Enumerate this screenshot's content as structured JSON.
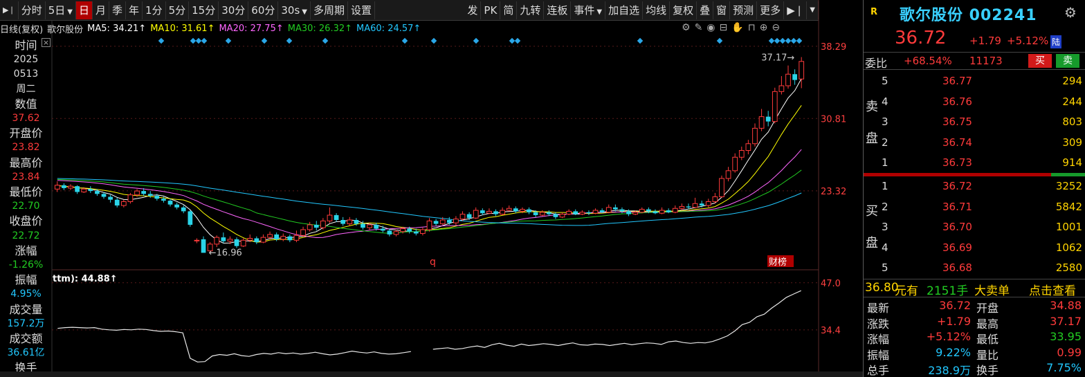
{
  "toolbar": {
    "items": [
      {
        "label": "分时",
        "icon": "arrow-right-bar-icon"
      },
      {
        "label": "5日",
        "caret": true
      },
      {
        "label": "日",
        "active": true
      },
      {
        "label": "月"
      },
      {
        "label": "季"
      },
      {
        "label": "年"
      },
      {
        "label": "1分"
      },
      {
        "label": "5分"
      },
      {
        "label": "15分"
      },
      {
        "label": "30分"
      },
      {
        "label": "60分"
      },
      {
        "label": "30s",
        "caret": true
      },
      {
        "label": "多周期"
      },
      {
        "label": "设置"
      }
    ],
    "right_items": [
      {
        "label": "发"
      },
      {
        "label": "PK"
      },
      {
        "label": "简"
      },
      {
        "label": "九转"
      },
      {
        "label": "连板"
      },
      {
        "label": "事件",
        "caret": true
      },
      {
        "label": "加自选"
      },
      {
        "label": "均线"
      },
      {
        "label": "复权"
      },
      {
        "label": "叠"
      },
      {
        "label": "窗"
      },
      {
        "label": "预测"
      },
      {
        "label": "更多"
      }
    ]
  },
  "legend": {
    "prefix": "日线(复权)",
    "stock": "歌尔股份",
    "ma": [
      {
        "text": "MA5: 34.21↑",
        "color": "#ffffff"
      },
      {
        "text": "MA10: 31.61↑",
        "color": "#ffff00"
      },
      {
        "text": "MA20: 27.75↑",
        "color": "#ff66ff"
      },
      {
        "text": "MA30: 26.32↑",
        "color": "#22cc22"
      },
      {
        "text": "MA60: 24.57↑",
        "color": "#22c8ff"
      }
    ],
    "tool_icons": [
      "gear-icon",
      "pen-icon",
      "eye-icon",
      "toolbox-icon",
      "hand-icon",
      "lock-icon",
      "zoom-in-icon",
      "zoom-out-icon"
    ]
  },
  "datawin": [
    {
      "label": "时间",
      "values": [
        "2025",
        "0513",
        "周二"
      ],
      "color": "#dddddd"
    },
    {
      "label": "数值",
      "values": [
        "37.62"
      ],
      "color": "#ff3b3b"
    },
    {
      "label": "开盘价",
      "values": [
        "23.82"
      ],
      "color": "#ff3b3b"
    },
    {
      "label": "最高价",
      "values": [
        "23.84"
      ],
      "color": "#ff3b3b"
    },
    {
      "label": "最低价",
      "values": [
        "22.70"
      ],
      "color": "#22cc22"
    },
    {
      "label": "收盘价",
      "values": [
        "22.72"
      ],
      "color": "#22cc22"
    },
    {
      "label": "涨幅",
      "values": [
        "-1.26%"
      ],
      "color": "#22cc22"
    },
    {
      "label": "振幅",
      "values": [
        "4.95%"
      ],
      "color": "#22c8ff"
    },
    {
      "label": "成交量",
      "values": [
        "157.2万"
      ],
      "color": "#22c8ff"
    },
    {
      "label": "成交额",
      "values": [
        "36.61亿"
      ],
      "color": "#22c8ff"
    },
    {
      "label": "换手",
      "values": [],
      "color": "#dddddd"
    }
  ],
  "chart_data": {
    "type": "candlestick",
    "price_axis_ticks": [
      "38.29",
      "30.81",
      "23.32"
    ],
    "ylim": [
      15.5,
      39.5
    ],
    "annotations": {
      "high_label": "37.17",
      "low_label": "16.96",
      "event_marker": "q",
      "badge": "财榜"
    },
    "candles": [
      [
        23.5,
        23.9,
        24.3,
        23.2
      ],
      [
        23.9,
        23.6,
        24.1,
        23.4
      ],
      [
        23.6,
        23.8,
        24.0,
        23.4
      ],
      [
        23.8,
        23.2,
        23.9,
        23.0
      ],
      [
        23.2,
        23.5,
        23.7,
        23.1
      ],
      [
        23.5,
        23.3,
        23.8,
        23.1
      ],
      [
        23.3,
        23.0,
        23.5,
        22.8
      ],
      [
        23.0,
        22.7,
        23.2,
        22.5
      ],
      [
        22.7,
        22.4,
        22.9,
        22.1
      ],
      [
        22.4,
        21.8,
        22.6,
        21.6
      ],
      [
        21.8,
        22.2,
        22.4,
        21.6
      ],
      [
        22.2,
        22.9,
        23.1,
        22.0
      ],
      [
        22.9,
        23.3,
        23.5,
        22.7
      ],
      [
        23.3,
        23.0,
        23.6,
        22.8
      ],
      [
        23.0,
        22.8,
        23.3,
        22.6
      ],
      [
        22.8,
        22.5,
        23.0,
        22.3
      ],
      [
        22.5,
        22.3,
        22.7,
        22.1
      ],
      [
        22.3,
        21.9,
        22.5,
        21.7
      ],
      [
        21.9,
        21.6,
        22.1,
        21.4
      ],
      [
        21.6,
        21.2,
        21.8,
        21.0
      ],
      [
        21.2,
        19.8,
        21.3,
        19.6
      ],
      [
        18.2,
        18.2,
        18.4,
        17.9
      ],
      [
        18.3,
        16.9,
        18.6,
        16.9
      ],
      [
        17.1,
        17.8,
        18.0,
        16.96
      ],
      [
        17.8,
        18.5,
        18.7,
        17.5
      ],
      [
        18.5,
        18.1,
        19.0,
        17.9
      ],
      [
        18.1,
        18.3,
        18.6,
        17.8
      ],
      [
        18.3,
        17.6,
        18.5,
        17.4
      ],
      [
        17.6,
        18.2,
        18.4,
        17.5
      ],
      [
        18.2,
        18.4,
        18.8,
        18.0
      ],
      [
        18.4,
        18.0,
        18.6,
        17.8
      ],
      [
        18.0,
        18.5,
        18.8,
        17.9
      ],
      [
        18.5,
        18.8,
        19.1,
        18.3
      ],
      [
        18.8,
        18.3,
        19.0,
        18.1
      ],
      [
        18.3,
        18.6,
        18.9,
        18.1
      ],
      [
        18.6,
        18.2,
        18.8,
        18.0
      ],
      [
        18.2,
        18.7,
        19.2,
        18.0
      ],
      [
        18.7,
        19.3,
        19.6,
        18.6
      ],
      [
        19.3,
        19.8,
        20.1,
        19.1
      ],
      [
        19.8,
        19.5,
        20.2,
        19.2
      ],
      [
        19.5,
        20.2,
        20.5,
        19.3
      ],
      [
        20.2,
        20.8,
        21.6,
        20.0
      ],
      [
        20.8,
        20.3,
        21.0,
        20.1
      ],
      [
        20.3,
        19.9,
        20.6,
        19.7
      ],
      [
        19.9,
        20.3,
        20.6,
        19.7
      ],
      [
        20.3,
        19.9,
        20.5,
        19.7
      ],
      [
        19.9,
        19.5,
        20.2,
        19.3
      ],
      [
        19.5,
        19.8,
        20.0,
        19.3
      ],
      [
        19.8,
        19.4,
        20.0,
        19.2
      ],
      [
        19.4,
        19.2,
        19.7,
        19.0
      ],
      [
        19.2,
        18.8,
        19.4,
        18.6
      ],
      [
        18.8,
        19.1,
        19.3,
        18.6
      ],
      [
        19.1,
        19.4,
        19.6,
        18.9
      ],
      [
        19.4,
        19.1,
        19.6,
        18.9
      ],
      [
        19.1,
        18.9,
        19.4,
        18.7
      ],
      [
        18.9,
        19.3,
        19.5,
        18.7
      ],
      [
        19.3,
        20.2,
        20.5,
        19.1
      ],
      [
        20.2,
        19.9,
        20.4,
        19.7
      ],
      [
        19.9,
        20.3,
        20.6,
        19.8
      ],
      [
        20.3,
        20.0,
        20.6,
        19.8
      ],
      [
        20.0,
        20.4,
        20.7,
        19.8
      ],
      [
        20.4,
        20.9,
        21.2,
        20.2
      ],
      [
        20.9,
        20.5,
        21.1,
        20.3
      ],
      [
        20.5,
        21.3,
        21.6,
        20.4
      ],
      [
        21.3,
        21.0,
        21.5,
        20.8
      ],
      [
        21.0,
        21.2,
        21.5,
        20.9
      ],
      [
        21.2,
        20.9,
        21.4,
        20.7
      ],
      [
        20.9,
        21.3,
        21.6,
        20.8
      ],
      [
        21.3,
        21.5,
        21.8,
        21.2
      ],
      [
        21.5,
        21.2,
        21.7,
        21.0
      ],
      [
        21.2,
        21.4,
        21.6,
        21.0
      ],
      [
        21.4,
        21.1,
        21.6,
        20.9
      ],
      [
        21.1,
        20.8,
        21.3,
        20.6
      ],
      [
        20.8,
        21.1,
        21.3,
        20.7
      ],
      [
        21.1,
        20.9,
        21.3,
        20.7
      ],
      [
        20.9,
        20.6,
        21.1,
        20.4
      ],
      [
        20.6,
        20.9,
        21.1,
        20.5
      ],
      [
        20.9,
        21.2,
        21.4,
        20.8
      ],
      [
        21.2,
        20.9,
        21.4,
        20.8
      ],
      [
        20.9,
        21.1,
        21.3,
        20.8
      ],
      [
        21.1,
        21.0,
        21.3,
        20.8
      ],
      [
        21.0,
        21.3,
        21.5,
        20.9
      ],
      [
        21.3,
        21.1,
        21.5,
        21.0
      ],
      [
        21.1,
        21.6,
        21.9,
        21.0
      ],
      [
        21.6,
        21.4,
        21.9,
        21.2
      ],
      [
        21.4,
        21.2,
        21.6,
        21.0
      ],
      [
        21.2,
        20.9,
        21.4,
        20.7
      ],
      [
        20.9,
        21.1,
        21.3,
        20.8
      ],
      [
        21.1,
        21.4,
        21.6,
        21.0
      ],
      [
        21.4,
        21.2,
        21.6,
        21.0
      ],
      [
        21.2,
        21.0,
        21.4,
        20.9
      ],
      [
        21.0,
        21.3,
        21.6,
        20.9
      ],
      [
        21.3,
        21.1,
        21.5,
        21.0
      ],
      [
        21.1,
        21.5,
        21.8,
        21.0
      ],
      [
        21.5,
        21.7,
        22.0,
        21.3
      ],
      [
        21.7,
        21.6,
        22.0,
        21.4
      ],
      [
        21.6,
        22.0,
        22.6,
        21.5
      ],
      [
        22.0,
        21.8,
        22.3,
        21.6
      ],
      [
        21.8,
        22.2,
        22.5,
        21.6
      ],
      [
        22.2,
        22.7,
        23.1,
        22.0
      ],
      [
        22.7,
        24.6,
        24.9,
        22.6
      ],
      [
        24.6,
        25.4,
        25.8,
        24.3
      ],
      [
        25.4,
        26.8,
        27.2,
        25.2
      ],
      [
        26.8,
        27.5,
        27.9,
        26.5
      ],
      [
        27.5,
        28.2,
        28.6,
        27.1
      ],
      [
        28.2,
        29.8,
        30.3,
        27.9
      ],
      [
        29.8,
        31.0,
        31.8,
        29.5
      ],
      [
        31.0,
        30.5,
        31.6,
        30.0
      ],
      [
        30.5,
        33.6,
        34.0,
        30.3
      ],
      [
        33.6,
        34.2,
        35.2,
        33.3
      ],
      [
        34.2,
        35.4,
        36.3,
        33.9
      ],
      [
        35.4,
        34.8,
        35.9,
        34.3
      ],
      [
        34.9,
        36.72,
        37.17,
        33.95
      ]
    ],
    "ma_lines": [
      {
        "name": "MA5",
        "color": "#ffffff"
      },
      {
        "name": "MA10",
        "color": "#ffff00"
      },
      {
        "name": "MA20",
        "color": "#ff66ff"
      },
      {
        "name": "MA30",
        "color": "#22cc22"
      },
      {
        "name": "MA60",
        "color": "#22c8ff"
      }
    ],
    "sub_indicator": {
      "label": "ttm): 44.88↑",
      "ticks": [
        "47.0",
        "34.4"
      ],
      "ylim": [
        24,
        49
      ],
      "values": [
        34.8,
        35.0,
        35.1,
        35.0,
        34.9,
        35.0,
        34.6,
        34.4,
        34.3,
        34.5,
        34.4,
        34.6,
        34.5,
        34.2,
        34.0,
        34.1,
        33.9,
        33.6,
        26.8,
        25.8,
        25.9,
        27.4,
        27.8,
        27.6,
        28.0,
        27.5,
        27.3,
        27.8,
        28.1,
        27.9,
        28.3,
        28.0,
        28.2,
        27.9,
        28.1,
        28.4,
        28.0,
        27.7,
        27.9,
        28.3,
        28.7,
        28.4,
        28.2,
        28.5,
        28.1,
        27.9,
        28.0,
        28.3,
        28.6,
        null,
        null,
        29.2,
        29.4,
        29.6,
        29.2,
        29.4,
        29.8,
        30.1,
        29.7,
        30.4,
        30.8,
        30.3,
        30.0,
        30.6,
        30.2,
        30.4,
        30.7,
        30.5,
        30.2,
        30.6,
        30.9,
        30.4,
        30.3,
        30.6,
        30.5,
        30.2,
        30.5,
        30.8,
        30.4,
        30.7,
        30.9,
        30.8,
        30.5,
        31.2,
        31.4,
        31.0,
        30.8,
        31.0,
        30.9,
        31.3,
        32.0,
        32.8,
        34.1,
        35.8,
        36.4,
        37.9,
        38.6,
        40.2,
        41.6,
        43.1,
        44.0,
        44.88
      ]
    }
  },
  "right_panel": {
    "logo": "R",
    "title": "歌尔股份 002241",
    "price": "36.72",
    "change": "+1.79",
    "pct": "+5.12%",
    "exchange_badge": "陆",
    "wb_label": "委比",
    "wb_pct": "+68.54%",
    "wb_diff": "11173",
    "buy_label": "买",
    "sell_label": "卖",
    "ask_side_label": "卖盘",
    "bid_side_label": "买盘",
    "asks": [
      {
        "level": "5",
        "price": "36.77",
        "qty": "294"
      },
      {
        "level": "4",
        "price": "36.76",
        "qty": "244"
      },
      {
        "level": "3",
        "price": "36.75",
        "qty": "803"
      },
      {
        "level": "2",
        "price": "36.74",
        "qty": "309"
      },
      {
        "level": "1",
        "price": "36.73",
        "qty": "914"
      }
    ],
    "bids": [
      {
        "level": "1",
        "price": "36.72",
        "qty": "3252"
      },
      {
        "level": "2",
        "price": "36.71",
        "qty": "5842"
      },
      {
        "level": "3",
        "price": "36.70",
        "qty": "1001"
      },
      {
        "level": "4",
        "price": "36.69",
        "qty": "1062"
      },
      {
        "level": "5",
        "price": "36.68",
        "qty": "2580"
      }
    ],
    "deal": {
      "price": "36.80",
      "unit": "元有",
      "qty": "2151手",
      "kind": "大卖单",
      "link": "点击查看"
    },
    "stats": [
      {
        "k": "最新",
        "v": "36.72",
        "k2": "开盘",
        "v2": "34.88"
      },
      {
        "k": "涨跌",
        "v": "+1.79",
        "k2": "最高",
        "v2": "37.17"
      },
      {
        "k": "涨幅",
        "v": "+5.12%",
        "k2": "最低",
        "v2": "33.95",
        "v2color": "#22cc22"
      },
      {
        "k": "振幅",
        "v": "9.22%",
        "k2": "量比",
        "v2": "0.99",
        "vcolor": "#22c8ff",
        "v2color": "#ff3b3b"
      },
      {
        "k": "总手",
        "v": "238.9万",
        "k2": "换手",
        "v2": "7.75%",
        "vcolor": "#22c8ff",
        "v2color": "#22c8ff"
      }
    ]
  }
}
